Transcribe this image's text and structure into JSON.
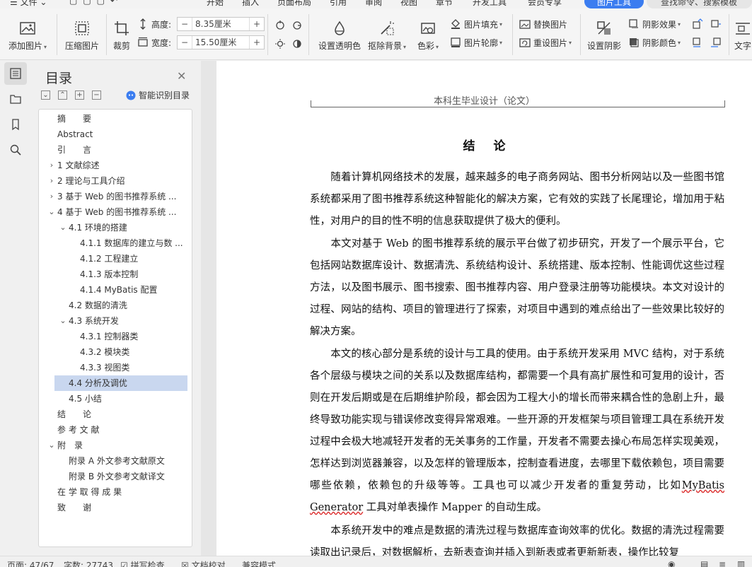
{
  "menu": {
    "file_label": "文件",
    "tabs": [
      "开始",
      "插入",
      "页面布局",
      "引用",
      "审阅",
      "视图",
      "章节",
      "开发工具",
      "会员专享"
    ],
    "active_tab": "图片工具",
    "search_placeholder": "查找命令、搜索模板"
  },
  "ribbon": {
    "add_picture": "添加图片",
    "compress_picture": "压缩图片",
    "crop": "裁剪",
    "height_label": "高度:",
    "height_value": "8.35厘米",
    "width_label": "宽度:",
    "width_value": "15.50厘米",
    "set_transparent": "设置透明色",
    "remove_background": "抠除背景",
    "color": "色彩",
    "picture_fill": "图片填充",
    "picture_outline": "图片轮廓",
    "replace_picture": "替换图片",
    "reset_picture": "重设图片",
    "set_shadow": "设置阴影",
    "shadow_effect": "阴影效果",
    "shadow_color": "阴影颜色",
    "text_wrap": "文字"
  },
  "toc": {
    "title": "目录",
    "smart_label": "智能识别目录",
    "items": [
      {
        "label": "摘　　要",
        "level": 0,
        "arrow": ""
      },
      {
        "label": "Abstract",
        "level": 0,
        "arrow": ""
      },
      {
        "label": "引　　言",
        "level": 0,
        "arrow": ""
      },
      {
        "label": "1 文献综述",
        "level": 0,
        "arrow": "›"
      },
      {
        "label": "2 理论与工具介绍",
        "level": 0,
        "arrow": "›"
      },
      {
        "label": "3  基于 Web 的图书推荐系统 ...",
        "level": 0,
        "arrow": "›"
      },
      {
        "label": "4  基于 Web 的图书推荐系统 ...",
        "level": 0,
        "arrow": "⌄"
      },
      {
        "label": "4.1  环境的搭建",
        "level": 1,
        "arrow": "⌄"
      },
      {
        "label": "4.1.1  数据库的建立与数 ...",
        "level": 2,
        "arrow": ""
      },
      {
        "label": "4.1.2  工程建立",
        "level": 2,
        "arrow": ""
      },
      {
        "label": "4.1.3  版本控制",
        "level": 2,
        "arrow": ""
      },
      {
        "label": "4.1.4 MyBatis 配置",
        "level": 2,
        "arrow": ""
      },
      {
        "label": "4.2  数据的清洗",
        "level": 1,
        "arrow": ""
      },
      {
        "label": "4.3  系统开发",
        "level": 1,
        "arrow": "⌄"
      },
      {
        "label": "4.3.1  控制器类",
        "level": 2,
        "arrow": ""
      },
      {
        "label": "4.3.2  模块类",
        "level": 2,
        "arrow": ""
      },
      {
        "label": "4.3.3  视图类",
        "level": 2,
        "arrow": ""
      },
      {
        "label": "4.4  分析及调优",
        "level": 1,
        "arrow": "",
        "selected": true
      },
      {
        "label": "4.5  小结",
        "level": 1,
        "arrow": ""
      },
      {
        "label": "结　　论",
        "level": 0,
        "arrow": ""
      },
      {
        "label": "参 考 文 献",
        "level": 0,
        "arrow": ""
      },
      {
        "label": "附　录",
        "level": 0,
        "arrow": "⌄"
      },
      {
        "label": "附录 A  外文参考文献原文",
        "level": 1,
        "arrow": ""
      },
      {
        "label": "附录 B  外文参考文献译文",
        "level": 1,
        "arrow": ""
      },
      {
        "label": "在 学 取 得 成 果",
        "level": 0,
        "arrow": ""
      },
      {
        "label": "致　　谢",
        "level": 0,
        "arrow": ""
      }
    ]
  },
  "document": {
    "header": "本科生毕业设计（论文）",
    "title": "结论",
    "paragraphs": [
      "　　随着计算机网络技术的发展，越来越多的电子商务网站、图书分析网站以及一些图书馆系统都采用了图书推荐系统这种智能化的解决方案，它有效的实践了长尾理论，增加用于粘性，对用户的目的性不明的信息获取提供了极大的便利。",
      "　　本文对基于 Web 的图书推荐系统的展示平台做了初步研究，开发了一个展示平台，它包括网站数据库设计、数据清洗、系统结构设计、系统搭建、版本控制、性能调优这些过程方法，以及图书展示、图书搜索、图书推荐内容、用户登录注册等功能模块。本文对设计的过程、网站的结构、项目的管理进行了探索，对项目中遇到的难点给出了一些效果比较好的解决方案。",
      "　　本文的核心部分是系统的设计与工具的使用。由于系统开发采用 MVC 结构，对于系统各个层级与模块之间的关系以及数据库结构，都需要一个具有高扩展性和可复用的设计，否则在开发后期或是在后期维护阶段，都会因为工程大小的增长而带来耦合性的急剧上升，最终导致功能实现与错误修改变得异常艰难。一些开源的开发框架与项目管理工具在系统开发过程中会极大地减轻开发者的无关事务的工作量，开发者不需要去操心布局怎样实现美观，怎样达到浏览器兼容，以及怎样的管理版本，控制查看进度，去哪里下载依赖包，项目需要哪些依赖，依赖包的升级等等。工具也可以减少开发者的重复劳动，比如",
      "MyBatis Generator",
      " 工具对单表操作 Mapper 的自动生成。",
      "　　本系统开发中的难点是数据的清洗过程与数据库查询效率的优化。数据的清洗过程需要读取出记录后，对数据解析，去新表查询并插入到新表或者更新新表，操作比较复"
    ]
  },
  "status": {
    "page": "页面: 47/67",
    "words": "字数: 27743",
    "spellcheck": "拼写检查",
    "doc_check": "文档校对",
    "compat_mode": "兼容模式"
  },
  "colors": {
    "accent": "#3b7df0",
    "selection": "#c9d7ef"
  }
}
